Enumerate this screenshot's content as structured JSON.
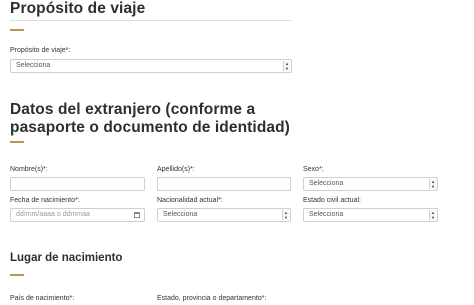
{
  "sections": {
    "purpose": {
      "title": "Propósito de viaje"
    },
    "foreigner": {
      "title_line1": "Datos del extranjero (conforme a",
      "title_line2": "pasaporte o documento de identidad)"
    },
    "birthplace": {
      "title": "Lugar de nacimiento"
    }
  },
  "fields": {
    "proposito": {
      "label": "Propósito de viaje*:",
      "value": "Selecciona"
    },
    "nombre": {
      "label": "Nombre(s)*:",
      "value": ""
    },
    "apellido": {
      "label": "Apellido(s)*:",
      "value": ""
    },
    "sexo": {
      "label": "Sexo*:",
      "value": "Selecciona"
    },
    "fecha": {
      "label": "Fecha de nacimiento*:",
      "placeholder": "dd/mm/aaaa o ddmmaa"
    },
    "nacionalidad": {
      "label": "Nacionalidad actual*:",
      "value": "Selecciona"
    },
    "estado_civil": {
      "label": "Estado civil actual:",
      "value": "Selecciona"
    },
    "pais_nacimiento": {
      "label": "País de nacimiento*:"
    },
    "estado_provincia": {
      "label": "Estado, provincia o departamento*:"
    }
  },
  "icons": {
    "select_arrow": "up-down-arrows-icon",
    "calendar": "calendar-icon"
  },
  "colors": {
    "accent": "#b7965c",
    "border": "#cfcfcf",
    "rule": "#dedede"
  }
}
